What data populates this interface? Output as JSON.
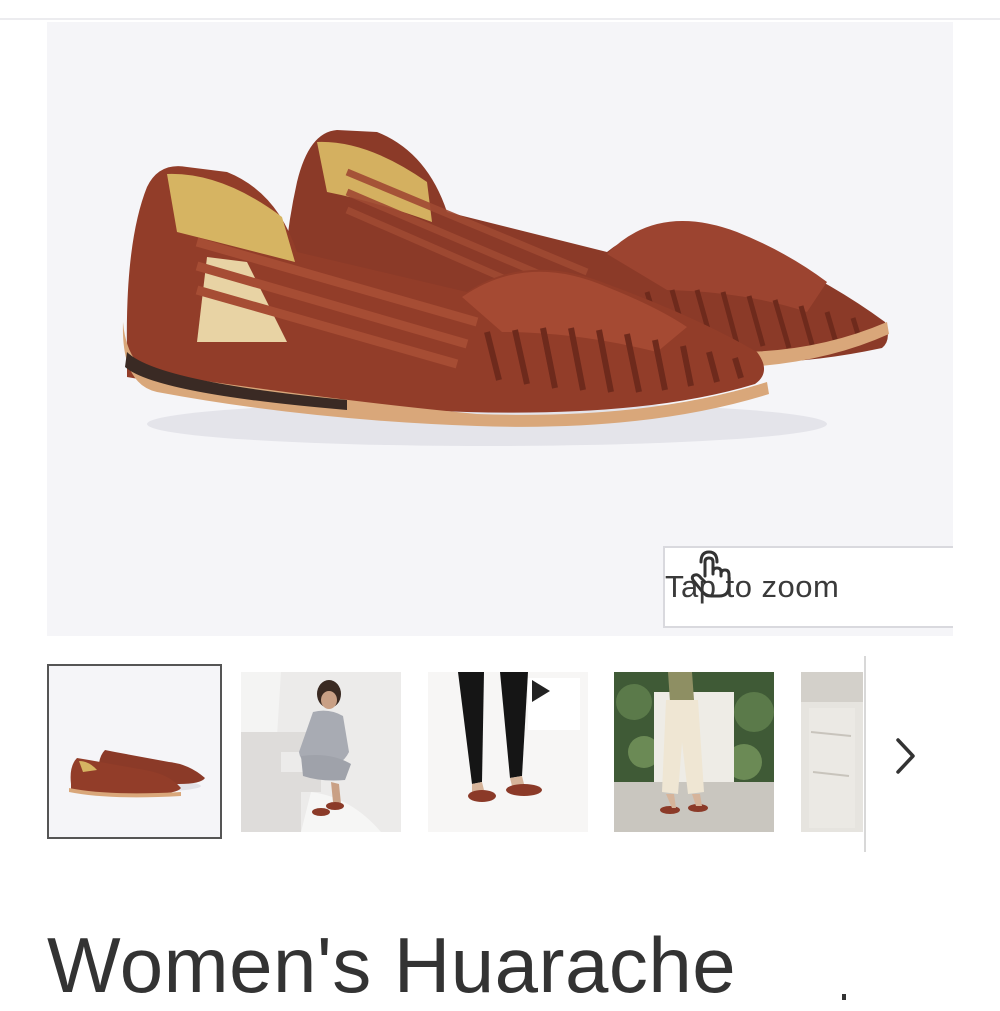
{
  "hero": {
    "zoom_label": "Tap to zoom",
    "zoom_icon": "tap-hand-icon"
  },
  "thumbnails": [
    {
      "name": "product-side-view",
      "selected": true
    },
    {
      "name": "model-sitting-on-stairs",
      "selected": false
    },
    {
      "name": "walking-video",
      "selected": false,
      "has_video": true
    },
    {
      "name": "model-standing-garden",
      "selected": false
    },
    {
      "name": "stone-wall-partial",
      "selected": false
    }
  ],
  "carousel": {
    "next_icon": "chevron-right-icon",
    "play_icon": "play-icon"
  },
  "product": {
    "title": "Women's Huarache"
  }
}
